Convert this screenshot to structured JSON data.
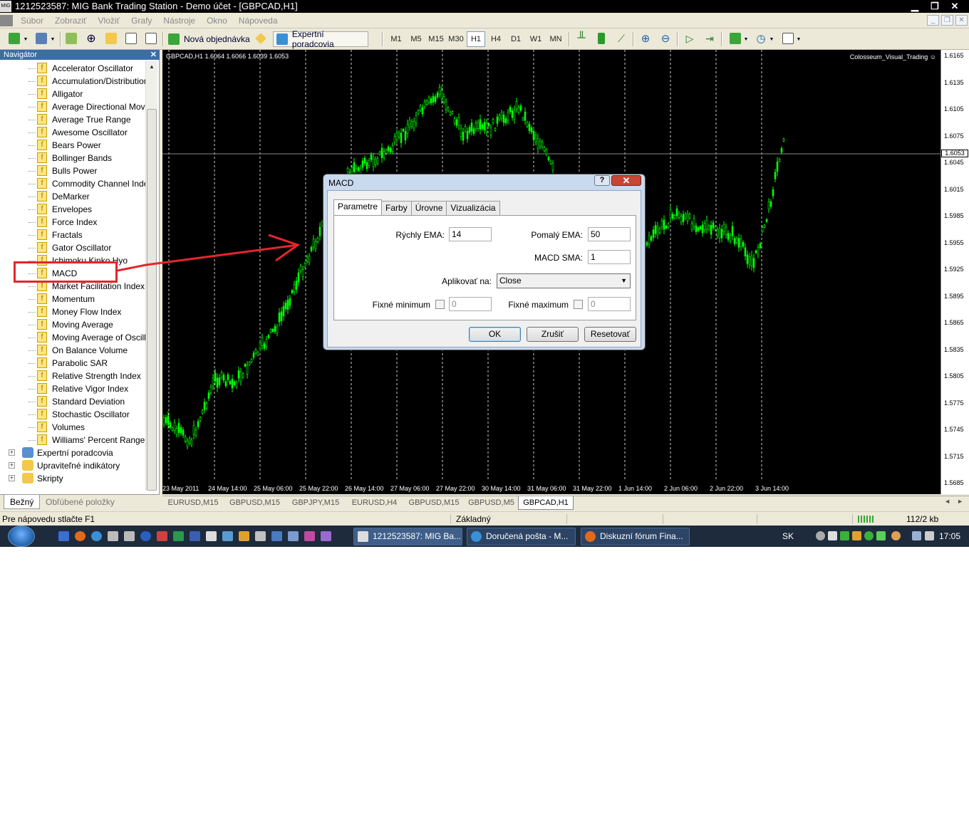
{
  "window": {
    "title": "1212523587: MIG Bank Trading Station - Demo účet - [GBPCAD,H1]",
    "app_icon": "MIG"
  },
  "menu": [
    "Súbor",
    "Zobraziť",
    "Vložiť",
    "Grafy",
    "Nástroje",
    "Okno",
    "Nápoveda"
  ],
  "toolbar": {
    "new_order": "Nová objednávka",
    "expert_advisors": "Expertní poradcovia",
    "timeframes": [
      "M1",
      "M5",
      "M15",
      "M30",
      "H1",
      "H4",
      "D1",
      "W1",
      "MN"
    ],
    "selected_timeframe": "H1"
  },
  "navigator": {
    "title": "Navigátor",
    "indicators": [
      "Accelerator Oscillator",
      "Accumulation/Distribution",
      "Alligator",
      "Average Directional Movement Index",
      "Average True Range",
      "Awesome Oscillator",
      "Bears Power",
      "Bollinger Bands",
      "Bulls Power",
      "Commodity Channel Index",
      "DeMarker",
      "Envelopes",
      "Force Index",
      "Fractals",
      "Gator Oscillator",
      "Ichimoku Kinko Hyo",
      "MACD",
      "Market Facilitation Index",
      "Momentum",
      "Money Flow Index",
      "Moving Average",
      "Moving Average of Oscillator",
      "On Balance Volume",
      "Parabolic SAR",
      "Relative Strength Index",
      "Relative Vigor Index",
      "Standard Deviation",
      "Stochastic Oscillator",
      "Volumes",
      "Williams' Percent Range"
    ],
    "groups": [
      "Expertní poradcovia",
      "Upraviteľné indikátory",
      "Skripty"
    ],
    "tabs": [
      "Bežný",
      "Obľúbené položky"
    ]
  },
  "chart": {
    "info": "GBPCAD,H1  1.6064 1.6066 1.6039 1.6053",
    "indicator_name": "Colosseum_Visual_Trading ☺",
    "current_price": "1.6053",
    "price_labels": [
      "1.6165",
      "1.6135",
      "1.6105",
      "1.6075",
      "1.6045",
      "1.6015",
      "1.5985",
      "1.5955",
      "1.5925",
      "1.5895",
      "1.5865",
      "1.5835",
      "1.5805",
      "1.5775",
      "1.5745",
      "1.5715",
      "1.5685"
    ],
    "time_labels": [
      "23 May 2011",
      "24 May 14:00",
      "25 May 06:00",
      "25 May 22:00",
      "26 May 14:00",
      "27 May 06:00",
      "27 May 22:00",
      "30 May 14:00",
      "31 May 06:00",
      "31 May 22:00",
      "1 Jun 14:00",
      "2 Jun 06:00",
      "2 Jun 22:00",
      "3 Jun 14:00"
    ],
    "bull_color": "#00ff00",
    "background": "#000000"
  },
  "chart_tabs": [
    "EURUSD,M15",
    "GBPUSD,M15",
    "GBPJPY,M15",
    "EURUSD,H4",
    "GBPUSD,M15",
    "GBPUSD,M5",
    "GBPCAD,H1"
  ],
  "active_chart_tab": "GBPCAD,H1",
  "status": {
    "help": "Pre nápovedu stlačte F1",
    "profile": "Základný",
    "traffic": "112/2 kb"
  },
  "dialog": {
    "title": "MACD",
    "tabs": [
      "Parametre",
      "Farby",
      "Úrovne",
      "Vizualizácia"
    ],
    "fast_ema_label": "Rýchly EMA:",
    "fast_ema": "14",
    "slow_ema_label": "Pomalý EMA:",
    "slow_ema": "50",
    "macd_sma_label": "MACD SMA:",
    "macd_sma": "1",
    "apply_label": "Aplikovať na:",
    "apply_value": "Close",
    "fixed_min_label": "Fixné minimum",
    "fixed_min": "0",
    "fixed_max_label": "Fixné maximum",
    "fixed_max": "0",
    "ok": "OK",
    "cancel": "Zrušiť",
    "reset": "Resetovať"
  },
  "taskbar": {
    "tasks": [
      "1212523587: MIG Ba...",
      "Doručená pošta - M...",
      "Diskuzní fórum Fina..."
    ],
    "lang": "SK",
    "clock": "17:05"
  },
  "annotation_color": "#e3262b"
}
